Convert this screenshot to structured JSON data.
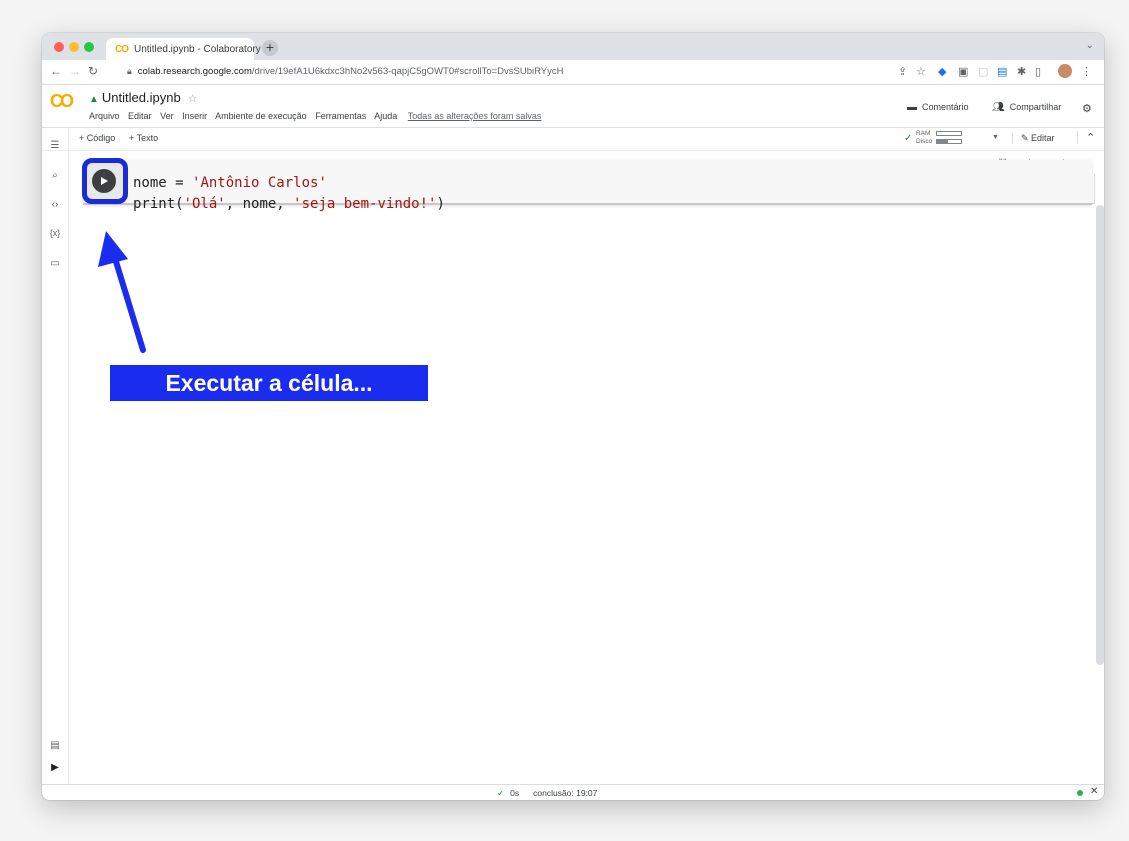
{
  "browser": {
    "tab_title": "Untitled.ipynb - Colaboratory",
    "tab_logo": "CO",
    "url_domain": "colab.research.google.com",
    "url_path": "/drive/19efA1U6kdxc3hNo2v563-qapjC5gOWT0#scrollTo=DvsSUbiRYycH"
  },
  "colab": {
    "logo": "CO",
    "file_name": "Untitled.ipynb",
    "menus": [
      "Arquivo",
      "Editar",
      "Ver",
      "Inserir",
      "Ambiente de execução",
      "Ferramentas",
      "Ajuda"
    ],
    "saved_status": "Todas as alterações foram salvas",
    "comment_label": "Comentário",
    "share_label": "Compartilhar"
  },
  "toolbar": {
    "add_code": "+ Código",
    "add_text": "+ Texto",
    "ram_label": "RAM",
    "disk_label": "Disco",
    "edit_label": "Editar"
  },
  "cell": {
    "line1": {
      "var": "nome",
      "op": " = ",
      "str": "'Antônio Carlos'"
    },
    "line2": {
      "fn": "print(",
      "s1": "'Olá'",
      "mid": ", nome, ",
      "s2": "'seja bem-vindo!'",
      "end": ")"
    }
  },
  "annotation": {
    "label": "Executar a célula...",
    "highlight_color": "#1a2cd6",
    "label_bg": "#1a2cf0"
  },
  "statusbar": {
    "check": "✓",
    "duration": "0s",
    "completion": "conclusão: 19:07"
  },
  "icons": {
    "back": "back-arrow-icon",
    "forward": "forward-arrow-icon",
    "reload": "reload-icon",
    "run": "play-icon"
  }
}
